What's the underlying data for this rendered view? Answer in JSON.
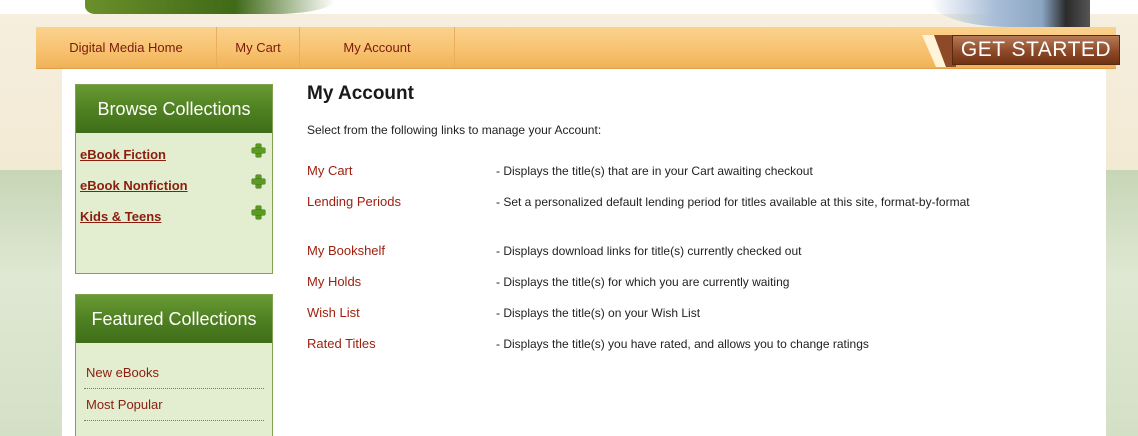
{
  "nav": {
    "items": [
      {
        "label": "Digital Media Home"
      },
      {
        "label": "My Cart"
      },
      {
        "label": "My Account"
      }
    ],
    "get_started_label": "GET STARTED"
  },
  "browse": {
    "title": "Browse Collections",
    "items": [
      {
        "label": "eBook Fiction"
      },
      {
        "label": "eBook Nonfiction"
      },
      {
        "label": "Kids & Teens"
      }
    ]
  },
  "featured": {
    "title": "Featured Collections",
    "items": [
      {
        "label": "New eBooks"
      },
      {
        "label": "Most Popular"
      }
    ]
  },
  "account": {
    "title": "My Account",
    "intro": "Select from the following links to manage your Account:",
    "links": [
      {
        "label": "My Cart",
        "desc": "- Displays the title(s) that are in your Cart awaiting checkout"
      },
      {
        "label": "Lending Periods",
        "desc": "- Set a personalized default lending period for titles available at this site, format-by-format"
      },
      {
        "label": "My Bookshelf",
        "desc": "- Displays download links for title(s) currently checked out"
      },
      {
        "label": "My Holds",
        "desc": "- Displays the title(s) for which you are currently waiting"
      },
      {
        "label": "Wish List",
        "desc": "- Displays the title(s) on your Wish List"
      },
      {
        "label": "Rated Titles",
        "desc": "- Displays the title(s) you have rated, and allows you to change ratings"
      }
    ]
  },
  "colors": {
    "accent": "#a02010",
    "nav_bg": "#f7c16e",
    "sidebar_header": "#4f8122",
    "sidebar_bg": "#e3edd0"
  }
}
